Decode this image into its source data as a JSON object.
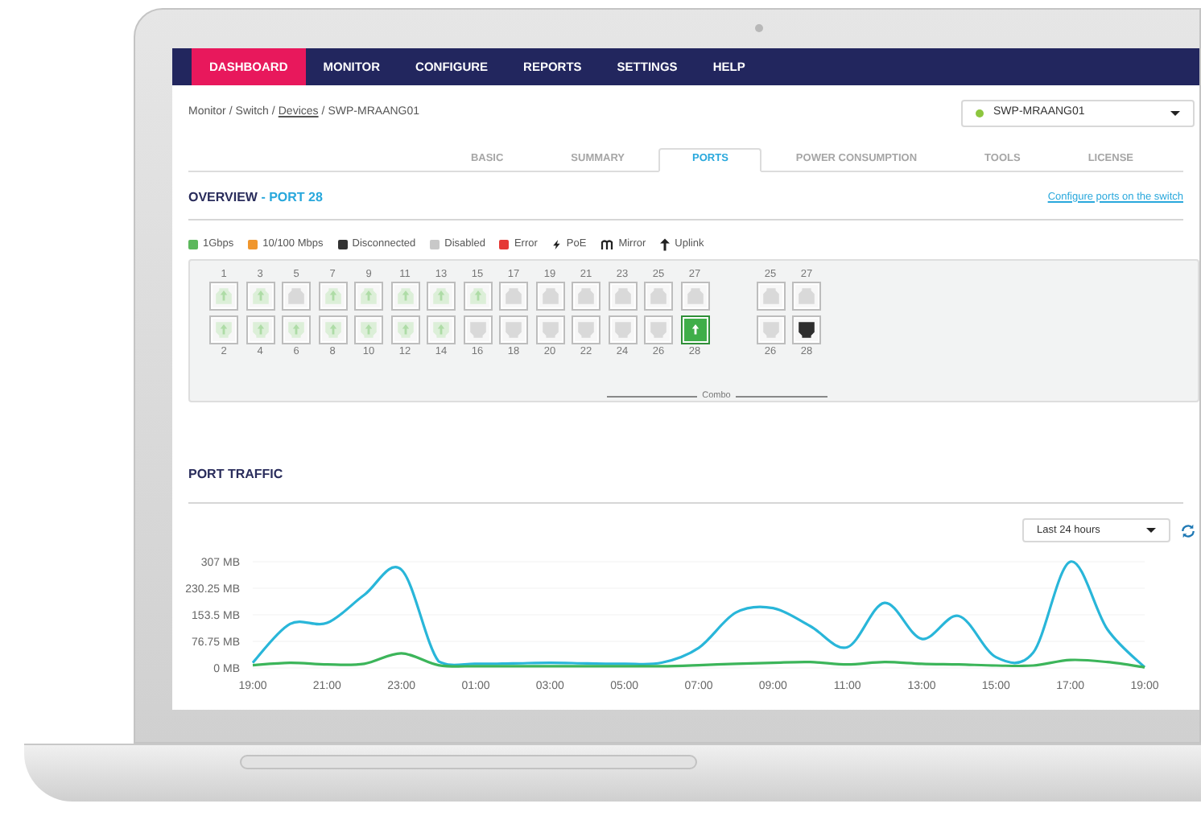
{
  "nav": [
    {
      "label": "DASHBOARD",
      "selected": true
    },
    {
      "label": "MONITOR",
      "selected": false
    },
    {
      "label": "CONFIGURE",
      "selected": false
    },
    {
      "label": "REPORTS",
      "selected": false
    },
    {
      "label": "SETTINGS",
      "selected": false
    },
    {
      "label": "HELP",
      "selected": false
    }
  ],
  "breadcrumb": [
    {
      "kind": "text",
      "label": "Monitor"
    },
    {
      "kind": "separator",
      "label": "/"
    },
    {
      "kind": "text",
      "label": "Switch"
    },
    {
      "kind": "separator",
      "label": "/"
    },
    {
      "kind": "link",
      "label": "Devices"
    },
    {
      "kind": "separator",
      "label": "/"
    },
    {
      "kind": "text",
      "label": "SWP-MRAANG01"
    }
  ],
  "device_select": {
    "value": "SWP-MRAANG01",
    "color": "#8dc63f"
  },
  "tabs": [
    {
      "label": "BASIC",
      "selected": false
    },
    {
      "label": "SUMMARY",
      "selected": false
    },
    {
      "label": "PORTS",
      "selected": true
    },
    {
      "label": "POWER CONSUMPTION",
      "selected": false
    },
    {
      "label": "TOOLS",
      "selected": false
    },
    {
      "label": "LICENSE",
      "selected": false
    }
  ],
  "overview": {
    "title": "OVERVIEW",
    "subtitle": " - PORT 28",
    "link": "Configure ports on the switch"
  },
  "legend": [
    {
      "kind": "swatch",
      "label": "1Gbps",
      "color": "#5cb85c"
    },
    {
      "kind": "swatch",
      "label": "10/100 Mbps",
      "color": "#f0962d"
    },
    {
      "kind": "swatch",
      "label": "Disconnected",
      "color": "#333333"
    },
    {
      "kind": "swatch",
      "label": "Disabled",
      "color": "#c8c8c8"
    },
    {
      "kind": "swatch",
      "label": "Error",
      "color": "#e53935"
    },
    {
      "kind": "poe",
      "label": "PoE"
    },
    {
      "kind": "mirror",
      "label": "Mirror"
    },
    {
      "kind": "uplink",
      "label": "Uplink"
    }
  ],
  "ports": {
    "main_top": [
      {
        "label": "1",
        "kind": "gigabit",
        "selected": false
      },
      {
        "label": "3",
        "kind": "gigabit",
        "selected": false
      },
      {
        "label": "5",
        "kind": "disabled",
        "selected": false
      },
      {
        "label": "7",
        "kind": "gigabit",
        "selected": false
      },
      {
        "label": "9",
        "kind": "gigabit",
        "selected": false
      },
      {
        "label": "11",
        "kind": "gigabit",
        "selected": false
      },
      {
        "label": "13",
        "kind": "gigabit",
        "selected": false
      },
      {
        "label": "15",
        "kind": "gigabit",
        "selected": false
      },
      {
        "label": "17",
        "kind": "disabled",
        "selected": false
      },
      {
        "label": "19",
        "kind": "disabled",
        "selected": false
      },
      {
        "label": "21",
        "kind": "disabled",
        "selected": false
      },
      {
        "label": "23",
        "kind": "disabled",
        "selected": false
      },
      {
        "label": "25",
        "kind": "disabled",
        "selected": false
      },
      {
        "label": "27",
        "kind": "disabled",
        "selected": false
      }
    ],
    "main_bottom": [
      {
        "label": "2",
        "kind": "gigabit",
        "selected": false
      },
      {
        "label": "4",
        "kind": "gigabit",
        "selected": false
      },
      {
        "label": "6",
        "kind": "gigabit",
        "selected": false
      },
      {
        "label": "8",
        "kind": "gigabit",
        "selected": false
      },
      {
        "label": "10",
        "kind": "gigabit",
        "selected": false
      },
      {
        "label": "12",
        "kind": "gigabit",
        "selected": false
      },
      {
        "label": "14",
        "kind": "gigabit",
        "selected": false
      },
      {
        "label": "16",
        "kind": "disabled",
        "selected": false
      },
      {
        "label": "18",
        "kind": "disabled",
        "selected": false
      },
      {
        "label": "20",
        "kind": "disabled",
        "selected": false
      },
      {
        "label": "22",
        "kind": "disabled",
        "selected": false
      },
      {
        "label": "24",
        "kind": "disabled",
        "selected": false
      },
      {
        "label": "26",
        "kind": "disabled",
        "selected": false
      },
      {
        "label": "28",
        "kind": "gigabit",
        "selected": true
      }
    ],
    "combo_top": [
      {
        "label": "25",
        "kind": "disabled",
        "selected": false
      },
      {
        "label": "27",
        "kind": "disabled",
        "selected": false
      }
    ],
    "combo_bottom": [
      {
        "label": "26",
        "kind": "disabled",
        "selected": false
      },
      {
        "label": "28",
        "kind": "disconnected",
        "selected": false
      }
    ],
    "combo_label": "Combo"
  },
  "traffic": {
    "title": "PORT TRAFFIC",
    "range": "Last 24 hours",
    "chart_data": {
      "type": "line",
      "categories": [
        "19:00",
        null,
        "21:00",
        null,
        "23:00",
        null,
        "01:00",
        null,
        "03:00",
        null,
        "05:00",
        null,
        "07:00",
        null,
        "09:00",
        null,
        "11:00",
        null,
        "13:00",
        null,
        "15:00",
        null,
        "17:00",
        null,
        "19:00"
      ],
      "series": [
        {
          "color": "#29b6d9",
          "values": [
            15,
            127,
            130,
            211,
            284,
            19,
            12,
            13,
            15,
            13,
            12,
            15,
            58,
            160,
            173,
            121,
            60,
            188,
            84,
            150,
            31,
            44,
            307,
            111,
            2
          ]
        },
        {
          "color": "#3cb55a",
          "values": [
            8,
            15,
            10,
            12,
            42,
            8,
            5,
            5,
            5,
            5,
            5,
            5,
            8,
            12,
            15,
            17,
            10,
            17,
            12,
            10,
            7,
            7,
            23,
            17,
            2
          ]
        }
      ],
      "ylim": [
        0,
        307
      ],
      "grid": true,
      "yticks": [
        {
          "value": 307,
          "label": "307 MB"
        },
        {
          "value": 230.25,
          "label": "230.25 MB"
        },
        {
          "value": 153.5,
          "label": "153.5 MB"
        },
        {
          "value": 76.75,
          "label": "76.75 MB"
        },
        {
          "value": 0,
          "label": "0 MB"
        }
      ]
    }
  }
}
